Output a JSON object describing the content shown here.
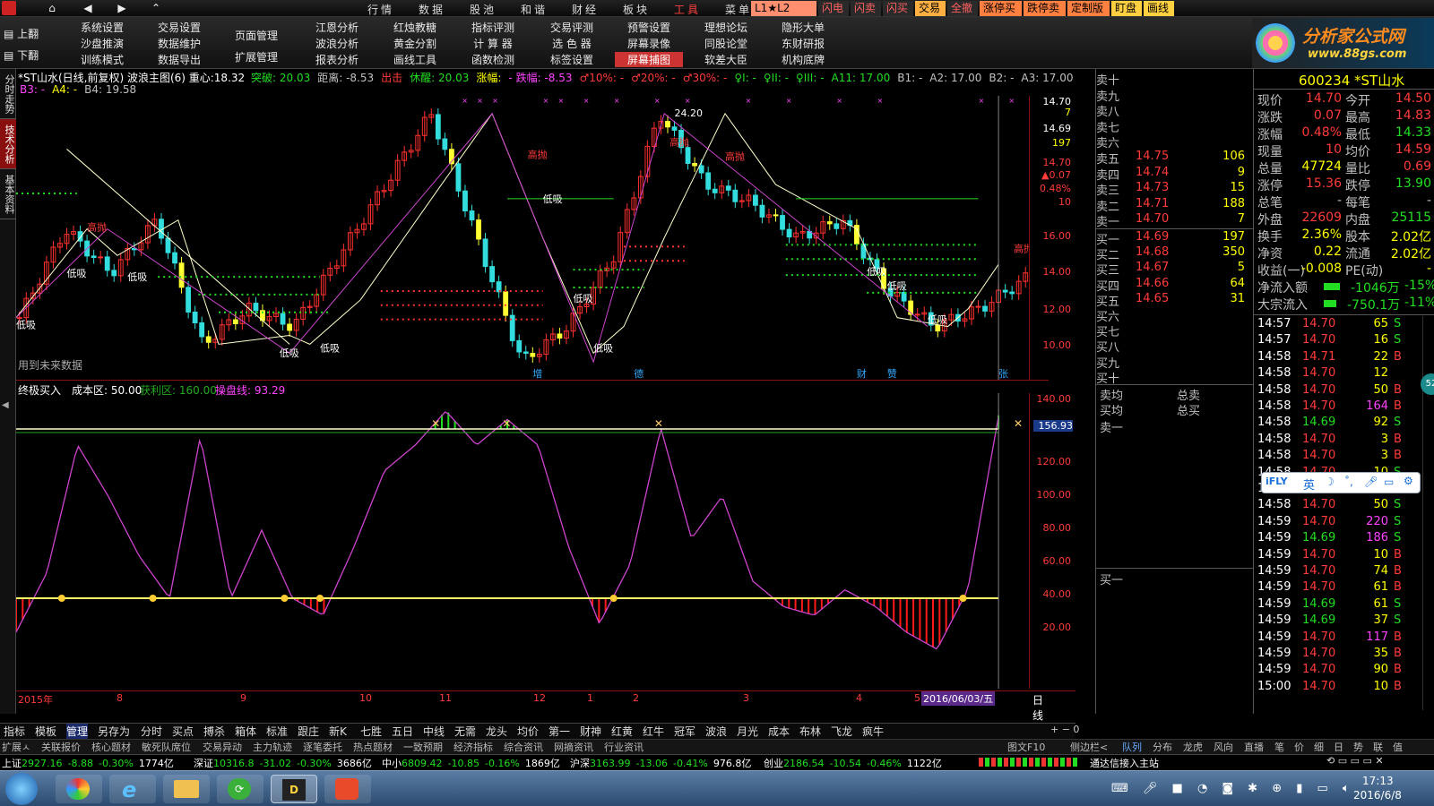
{
  "menubar": {
    "main_menu": [
      "行情",
      "数据",
      "股池",
      "和谐",
      "财经",
      "板块",
      "工具",
      "菜单"
    ],
    "status_tags": [
      "L1★L2",
      "闪电",
      "闪卖",
      "闪买",
      "交易",
      "全撤",
      "涨停买",
      "跌停卖",
      "定制版",
      "盯盘",
      "画线"
    ]
  },
  "toolbar": {
    "page_up": "上翻",
    "page_down": "下翻",
    "groups": [
      [
        "系统设置",
        "沙盘推演",
        "训练模式"
      ],
      [
        "交易设置",
        "数据维护",
        "数据导出"
      ],
      [
        "页面管理",
        "扩展管理"
      ],
      [
        "江恩分析",
        "波浪分析",
        "报表分析"
      ],
      [
        "红烛教糖",
        "黄金分割",
        "画线工具"
      ],
      [
        "指标评测",
        "计 算 器",
        "函数检测"
      ],
      [
        "交易评测",
        "选 色 器",
        "标签设置"
      ],
      [
        "预警设置",
        "屏幕录像",
        "屏幕捕图"
      ],
      [
        "理想论坛",
        "同股论堂",
        "软差大臣"
      ],
      [
        "隐形大单",
        "东财研报",
        "机构底牌"
      ]
    ],
    "brand_title": "分析家公式网",
    "brand_url": "www.88gs.com"
  },
  "left_tabs": [
    "分时走势",
    "技术分析",
    "基本资料"
  ],
  "chart_header": {
    "title": "*ST山水(日线,前复权) 波浪主图(6) 重心:18.32",
    "items": [
      {
        "text": "突破: 20.03",
        "color": "#22dd22"
      },
      {
        "text": "距离: -8.53",
        "color": "#c0c0c0"
      },
      {
        "text": "出击",
        "color": "#ff3b3b"
      },
      {
        "text": "休醒: 20.03",
        "color": "#22dd22"
      },
      {
        "text": "涨幅:",
        "color": "#ffff00"
      },
      {
        "text": "- 跌幅: -8.53",
        "color": "#ff44ff"
      },
      {
        "text": "♂10%: -",
        "color": "#ff3b3b"
      },
      {
        "text": "♂20%: -",
        "color": "#ff3b3b"
      },
      {
        "text": "♂30%: -",
        "color": "#ff3b3b"
      },
      {
        "text": "♀I: -",
        "color": "#22dd22"
      },
      {
        "text": "♀II: -",
        "color": "#22dd22"
      },
      {
        "text": "♀III: -",
        "color": "#22dd22"
      },
      {
        "text": "A11: 17.00",
        "color": "#22dd22"
      },
      {
        "text": "B1: -",
        "color": "#c0c0c0"
      },
      {
        "text": "A2: 17.00",
        "color": "#c0c0c0"
      },
      {
        "text": "B2: -",
        "color": "#c0c0c0"
      },
      {
        "text": "A3: 17.00",
        "color": "#c0c0c0"
      }
    ],
    "line2": [
      {
        "text": "B3: -",
        "color": "#ff44ff"
      },
      {
        "text": "A4: -",
        "color": "#ffff00"
      },
      {
        "text": "B4: 19.58",
        "color": "#c0c0c0"
      }
    ],
    "future_note": "用到未来数据"
  },
  "main_yaxis": [
    "14.70",
    "7",
    "14.69",
    "197",
    "14.70",
    "▲0.07",
    "0.48%",
    "10",
    "16.00",
    "14.00",
    "12.00",
    "10.00"
  ],
  "markers": {
    "high_sell": "高抛",
    "low_buy": "低吸",
    "zeng": "增",
    "de": "德",
    "cai": "财",
    "fu": "赞",
    "zhang": "张"
  },
  "sub_header": {
    "name": "终极买入",
    "cost_label": "成本区: 50.00",
    "profit_label": "获利区: 160.00",
    "ctrl_label": "操盘线: 93.29"
  },
  "sub_yaxis": [
    "156.93",
    "140.00",
    "120.00",
    "100.00",
    "80.00",
    "60.00",
    "40.00",
    "20.00"
  ],
  "xaxis": {
    "labels": [
      "2015年",
      "8",
      "9",
      "10",
      "11",
      "12",
      "1",
      "2",
      "3",
      "4",
      "5"
    ],
    "date_badge": "2016/06/03/五",
    "right_label": "日线"
  },
  "order_book": {
    "sell_labels": [
      "卖十",
      "卖九",
      "卖八",
      "卖七",
      "卖六",
      "卖五",
      "卖四",
      "卖三",
      "卖二",
      "卖一"
    ],
    "sell_prices": [
      "",
      "",
      "",
      "",
      "",
      "14.75",
      "14.74",
      "14.73",
      "14.71",
      "14.70"
    ],
    "sell_vols": [
      "",
      "",
      "",
      "",
      "",
      "106",
      "9",
      "15",
      "188",
      "7"
    ],
    "buy_labels": [
      "买一",
      "买二",
      "买三",
      "买四",
      "买五",
      "买六",
      "买七",
      "买八",
      "买九",
      "买十"
    ],
    "buy_prices": [
      "14.69",
      "14.68",
      "14.67",
      "14.66",
      "14.65",
      "",
      "",
      "",
      "",
      ""
    ],
    "buy_vols": [
      "197",
      "350",
      "5",
      "64",
      "31",
      "",
      "",
      "",
      "",
      ""
    ],
    "avg_sell": "卖均",
    "avg_buy": "买均",
    "total_sell": "总卖",
    "total_buy": "总买",
    "sell_one": "卖一",
    "buy_one": "买一"
  },
  "quote": {
    "code": "600234 *ST山水",
    "rows": [
      {
        "l1": "现价",
        "v1": "14.70",
        "c1": "#ff3b3b",
        "l2": "今开",
        "v2": "14.50",
        "c2": "#ff3b3b"
      },
      {
        "l1": "涨跌",
        "v1": "0.07",
        "c1": "#ff3b3b",
        "l2": "最高",
        "v2": "14.83",
        "c2": "#ff3b3b"
      },
      {
        "l1": "涨幅",
        "v1": "0.48%",
        "c1": "#ff3b3b",
        "l2": "最低",
        "v2": "14.33",
        "c2": "#22dd22"
      },
      {
        "l1": "现量",
        "v1": "10",
        "c1": "#ff3b3b",
        "l2": "均价",
        "v2": "14.59",
        "c2": "#ff3b3b"
      },
      {
        "l1": "总量",
        "v1": "47724",
        "c1": "#ffff00",
        "l2": "量比",
        "v2": "0.69",
        "c2": "#ff3b3b"
      },
      {
        "l1": "涨停",
        "v1": "15.36",
        "c1": "#ff3b3b",
        "l2": "跌停",
        "v2": "13.90",
        "c2": "#22dd22"
      },
      {
        "l1": "总笔",
        "v1": "-",
        "c1": "#c0c0c0",
        "l2": "每笔",
        "v2": "-",
        "c2": "#c0c0c0"
      },
      {
        "l1": "外盘",
        "v1": "22609",
        "c1": "#ff3b3b",
        "l2": "内盘",
        "v2": "25115",
        "c2": "#22dd22"
      },
      {
        "l1": "换手",
        "v1": "2.36%",
        "c1": "#ffff00",
        "l2": "股本",
        "v2": "2.02亿",
        "c2": "#ffff00"
      },
      {
        "l1": "净资",
        "v1": "0.22",
        "c1": "#ffff00",
        "l2": "流通",
        "v2": "2.02亿",
        "c2": "#ffff00"
      },
      {
        "l1": "收益(一)",
        "v1": "-0.008",
        "c1": "#ffff00",
        "l2": "PE(动)",
        "v2": "-",
        "c2": "#ffff00"
      }
    ],
    "net_inflow_label": "净流入额",
    "net_inflow_val": "-1046万",
    "net_inflow_pct": "-15%",
    "block_inflow_label": "大宗流入",
    "block_inflow_val": "-750.1万",
    "block_inflow_pct": "-11%"
  },
  "trades": [
    {
      "t": "14:57",
      "p": "14.70",
      "v": "65",
      "d": "S"
    },
    {
      "t": "14:57",
      "p": "14.70",
      "v": "16",
      "d": "S"
    },
    {
      "t": "14:58",
      "p": "14.71",
      "v": "22",
      "d": "B"
    },
    {
      "t": "14:58",
      "p": "14.70",
      "v": "12",
      "d": ""
    },
    {
      "t": "14:58",
      "p": "14.70",
      "v": "50",
      "d": "B"
    },
    {
      "t": "14:58",
      "p": "14.70",
      "v": "164",
      "d": "B"
    },
    {
      "t": "14:58",
      "p": "14.69",
      "v": "92",
      "d": "S"
    },
    {
      "t": "14:58",
      "p": "14.70",
      "v": "3",
      "d": "B"
    },
    {
      "t": "14:58",
      "p": "14.70",
      "v": "3",
      "d": "B"
    },
    {
      "t": "14:58",
      "p": "14.70",
      "v": "10",
      "d": "S"
    },
    {
      "t": "14:58",
      "p": "14.71",
      "v": "1",
      "d": "B"
    },
    {
      "t": "14:58",
      "p": "14.70",
      "v": "50",
      "d": "S"
    },
    {
      "t": "14:59",
      "p": "14.70",
      "v": "220",
      "d": "S"
    },
    {
      "t": "14:59",
      "p": "14.69",
      "v": "186",
      "d": "S"
    },
    {
      "t": "14:59",
      "p": "14.70",
      "v": "10",
      "d": "B"
    },
    {
      "t": "14:59",
      "p": "14.70",
      "v": "74",
      "d": "B"
    },
    {
      "t": "14:59",
      "p": "14.70",
      "v": "61",
      "d": "B"
    },
    {
      "t": "14:59",
      "p": "14.69",
      "v": "61",
      "d": "S"
    },
    {
      "t": "14:59",
      "p": "14.69",
      "v": "37",
      "d": "S"
    },
    {
      "t": "14:59",
      "p": "14.70",
      "v": "117",
      "d": "B"
    },
    {
      "t": "14:59",
      "p": "14.70",
      "v": "35",
      "d": "B"
    },
    {
      "t": "14:59",
      "p": "14.70",
      "v": "90",
      "d": "B"
    },
    {
      "t": "15:00",
      "p": "14.70",
      "v": "10",
      "d": "B"
    }
  ],
  "bottom_tabs": [
    "指标",
    "模板",
    "管理",
    "另存为",
    "分时",
    "买点",
    "搏杀",
    "箱体",
    "标准",
    "跟庄",
    "新K",
    "七胜",
    "五日",
    "中线",
    "无需",
    "龙头",
    "均价",
    "第一",
    "财神",
    "红黄",
    "红牛",
    "冠军",
    "波浪",
    "月光",
    "成本",
    "布林",
    "飞龙",
    "疯牛"
  ],
  "tab_row2": [
    "扩展ㅅ",
    "关联报价",
    "核心题材",
    "敏死队席位",
    "交易异动",
    "主力轨迹",
    "逐笔委托",
    "热点题材",
    "一致预期",
    "经济指标",
    "综合资讯",
    "网摘资讯",
    "行业资讯"
  ],
  "tab_row2_right": [
    "图文F10",
    "侧边栏<",
    "队列",
    "分布",
    "龙虎",
    "风向",
    "直播",
    "笔",
    "价",
    "细",
    "日",
    "势",
    "联",
    "值"
  ],
  "tickers": [
    {
      "name": "上证",
      "val": "2927.16",
      "chg": "-8.88",
      "pct": "-0.30%",
      "amt": "1774亿"
    },
    {
      "name": "深证",
      "val": "10316.8",
      "chg": "-31.02",
      "pct": "-0.30%",
      "amt": "3686亿"
    },
    {
      "name": "中小",
      "val": "6809.42",
      "chg": "-10.85",
      "pct": "-0.16%",
      "amt": "1869亿"
    },
    {
      "name": "沪深",
      "val": "3163.99",
      "chg": "-13.06",
      "pct": "-0.41%",
      "amt": "976.8亿"
    },
    {
      "name": "创业",
      "val": "2186.54",
      "chg": "-10.54",
      "pct": "-0.46%",
      "amt": "1122亿"
    }
  ],
  "ticker_status": "通达信接入主站",
  "ime": {
    "lang": "英",
    "brand": "iFLY"
  },
  "clock": {
    "time": "17:13",
    "date": "2016/6/8"
  },
  "chart_data": [
    {
      "type": "line",
      "title": "*ST山水(日线,前复权) 波浪主图(6)",
      "ylim": [
        9.0,
        25.0
      ],
      "x": [
        "2015年",
        "8",
        "9",
        "10",
        "11",
        "12",
        "1",
        "2",
        "3",
        "4",
        "5",
        "2016/06/03"
      ],
      "series": [
        {
          "name": "close",
          "values": [
            12.5,
            17.5,
            15,
            18,
            11,
            13,
            12,
            16,
            20,
            24,
            17,
            10,
            12,
            16,
            24,
            20,
            19,
            17,
            18,
            14,
            12,
            13,
            14.7
          ]
        }
      ],
      "annotations": [
        "高抛",
        "低吸",
        "24.20",
        "S",
        "B"
      ]
    },
    {
      "type": "line",
      "title": "终极买入",
      "ylim": [
        0,
        165
      ],
      "series": [
        {
          "name": "终极买入",
          "values": [
            30,
            65,
            140,
            110,
            75,
            50,
            145,
            50,
            90,
            50,
            40,
            80,
            125,
            140,
            160,
            140,
            155,
            140,
            80,
            35,
            70,
            150,
            85,
            110,
            60,
            45,
            40,
            55,
            45,
            30,
            20,
            55,
            156.93
          ]
        }
      ],
      "reference_lines": [
        {
          "name": "成本区",
          "value": 50
        },
        {
          "name": "获利区",
          "value": 160
        }
      ]
    }
  ]
}
